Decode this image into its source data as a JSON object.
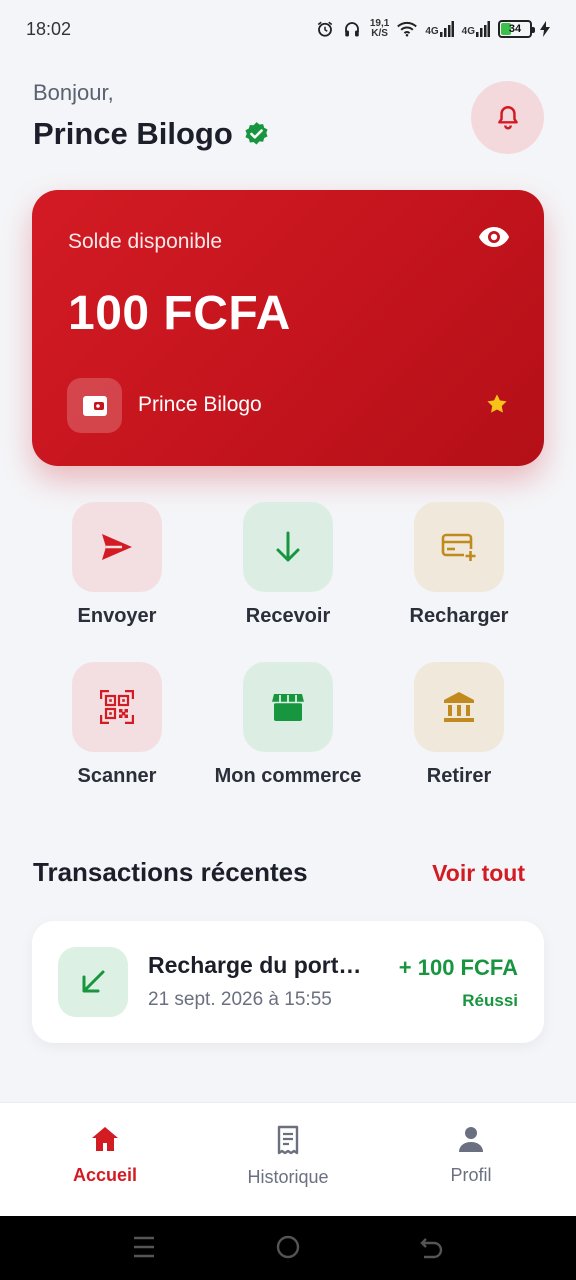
{
  "status_bar": {
    "time": "18:02",
    "net_speed_value": "19,1",
    "net_speed_unit": "K/S",
    "net_type_1": "4G",
    "net_type_2": "4G",
    "battery": "34"
  },
  "header": {
    "greeting": "Bonjour,",
    "username": "Prince Bilogo"
  },
  "balance": {
    "label": "Solde disponible",
    "amount": "100 FCFA",
    "holder": "Prince Bilogo"
  },
  "actions": [
    {
      "label": "Envoyer",
      "icon": "send-icon",
      "color": "#d31b24"
    },
    {
      "label": "Recevoir",
      "icon": "arrow-down-icon",
      "color": "#18963f"
    },
    {
      "label": "Recharger",
      "icon": "card-add-icon",
      "color": "#c08a1e"
    },
    {
      "label": "Scanner",
      "icon": "qr-code-icon",
      "color": "#d31b24"
    },
    {
      "label": "Mon commerce",
      "icon": "store-icon",
      "color": "#18963f"
    },
    {
      "label": "Retirer",
      "icon": "bank-icon",
      "color": "#c08a1e"
    }
  ],
  "transactions": {
    "title": "Transactions récentes",
    "see_all": "Voir tout",
    "items": [
      {
        "title": "Recharge du portefeuille",
        "date": "21 sept. 2026 à 15:55",
        "amount": "+ 100 FCFA",
        "status": "Réussi"
      }
    ]
  },
  "bottom_nav": [
    {
      "label": "Accueil",
      "active": true
    },
    {
      "label": "Historique",
      "active": false
    },
    {
      "label": "Profil",
      "active": false
    }
  ],
  "colors": {
    "primary": "#d31b24",
    "success": "#18963f",
    "gold": "#c08a1e",
    "background": "#f4f5f8"
  }
}
